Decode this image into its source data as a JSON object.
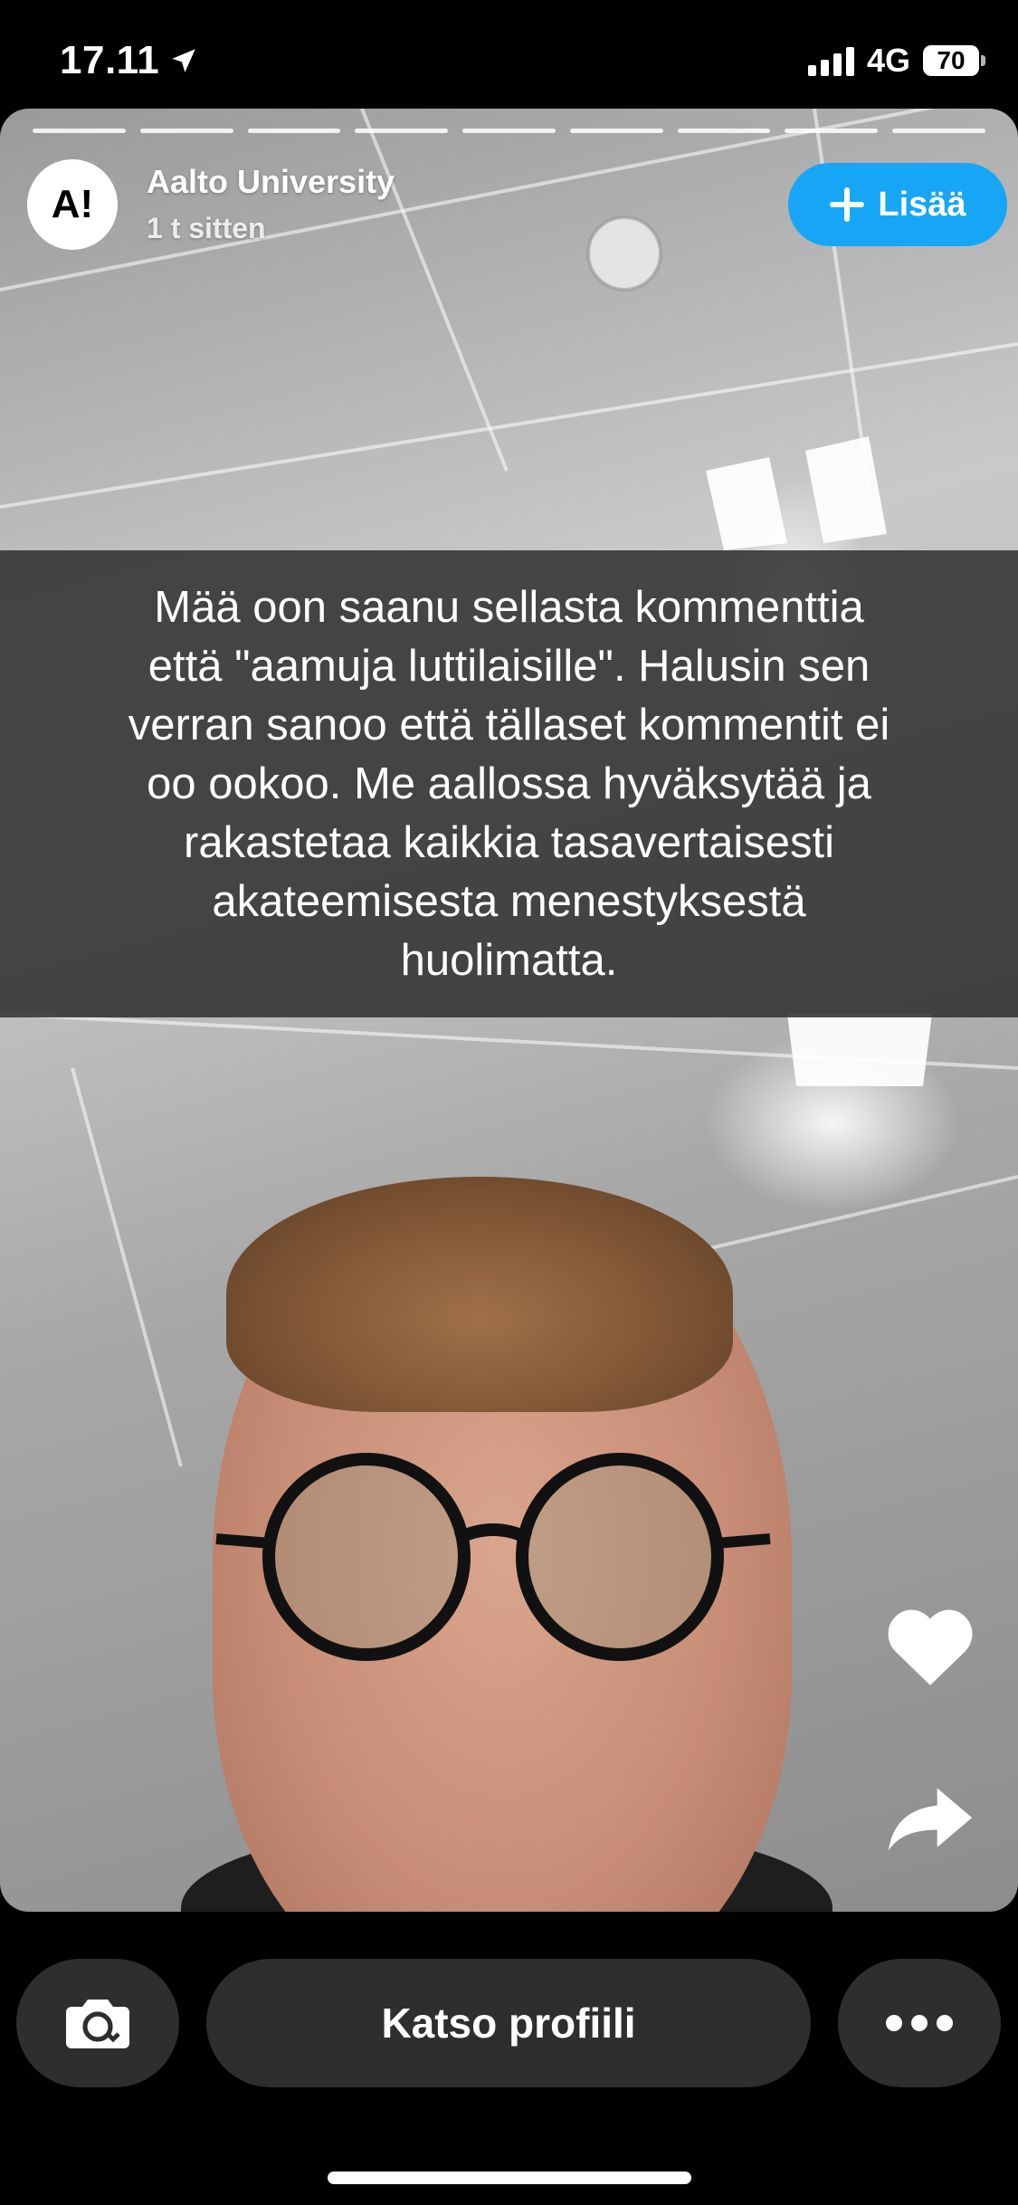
{
  "status_bar": {
    "time": "17.11",
    "network": "4G",
    "battery": "70"
  },
  "story": {
    "progress_segments": 9,
    "user": {
      "avatar_text": "A!",
      "name": "Aalto University",
      "timestamp": "1 t sitten"
    },
    "add_button_label": "Lisää",
    "caption": "Mää oon saanu sellasta kommenttia\nettä \"aamuja luttilaisille\". Halusin sen\nverran sanoo että tällaset kommentit ei\noo ookoo. Me aallossa hyväksytää ja\nrakastetaa kaikkia tasavertaisesti\nakateemisesta menestyksestä\nhuolimatta.",
    "actions": {
      "like_icon": "heart-icon",
      "share_icon": "share-arrow-icon"
    }
  },
  "bottom_bar": {
    "camera_icon": "camera-flip-icon",
    "profile_button_label": "Katso profiili",
    "more_icon": "more-dots-icon"
  }
}
